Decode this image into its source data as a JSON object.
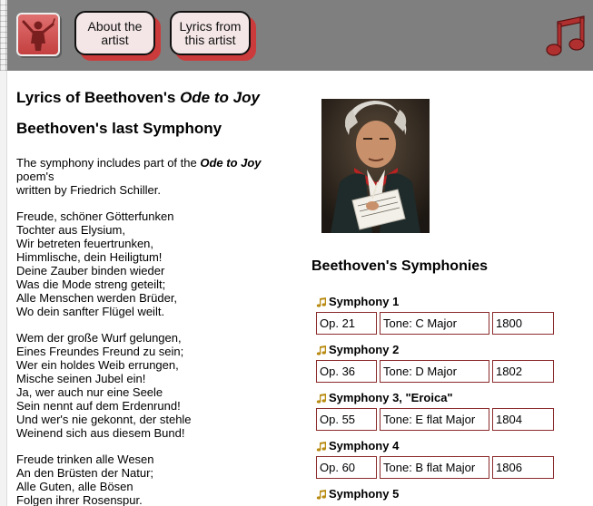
{
  "header": {
    "nav": [
      {
        "label": "About the artist"
      },
      {
        "label": "Lyrics from this artist"
      }
    ],
    "accent_color": "#cc3b3b",
    "bar_color": "#7f7f7f"
  },
  "main": {
    "title_prefix": "Lyrics of Beethoven's ",
    "title_em": "Ode to Joy",
    "subtitle": "Beethoven's last Symphony",
    "intro_part1": "The symphony includes part of the ",
    "intro_em": "Ode to Joy",
    "intro_part2": " poem's",
    "intro_line2": "written by Friedrich Schiller.",
    "stanzas": [
      [
        "Freude, schöner Götterfunken",
        "Tochter aus Elysium,",
        "Wir betreten feuertrunken,",
        "Himmlische, dein Heiligtum!",
        "Deine Zauber binden wieder",
        "Was die Mode streng geteilt;",
        "Alle Menschen werden Brüder,",
        "Wo dein sanfter Flügel weilt."
      ],
      [
        "Wem der große Wurf gelungen,",
        "Eines Freundes Freund zu sein;",
        "Wer ein holdes Weib errungen,",
        "Mische seinen Jubel ein!",
        "Ja, wer auch nur eine Seele",
        "Sein nennt auf dem Erdenrund!",
        "Und wer's nie gekonnt, der stehle",
        "Weinend sich aus diesem Bund!"
      ],
      [
        "Freude trinken alle Wesen",
        "An den Brüsten der Natur;",
        "Alle Guten, alle Bösen",
        "Folgen ihrer Rosenspur."
      ]
    ]
  },
  "symphonies": {
    "heading": "Beethoven's Symphonies",
    "items": [
      {
        "title": "Symphony 1",
        "op": "Op. 21",
        "tone": "Tone: C Major",
        "year": "1800"
      },
      {
        "title": "Symphony 2",
        "op": "Op. 36",
        "tone": "Tone: D Major",
        "year": "1802"
      },
      {
        "title": "Symphony 3, \"Eroica\"",
        "op": "Op. 55",
        "tone": "Tone: E flat Major",
        "year": "1804"
      },
      {
        "title": "Symphony 4",
        "op": "Op. 60",
        "tone": "Tone: B flat Major",
        "year": "1806"
      },
      {
        "title": "Symphony 5"
      }
    ]
  },
  "icons": {
    "logo": "conductor-icon",
    "corner": "music-note-icon",
    "bullet": "music-note-bullet-icon"
  }
}
